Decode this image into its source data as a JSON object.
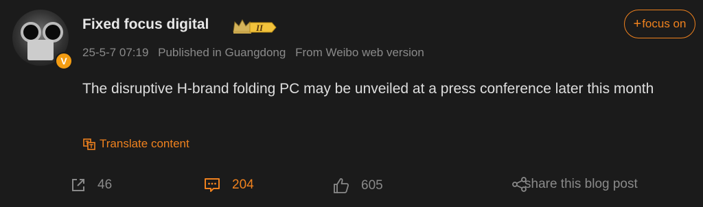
{
  "user": {
    "name": "Fixed focus digital",
    "verified_badge": "V",
    "level_badge": "II"
  },
  "follow_button": {
    "plus": "+",
    "label": "focus on"
  },
  "meta": {
    "timestamp": "25-5-7 07:19",
    "location": "Published in Guangdong",
    "source": "From Weibo web version"
  },
  "post": {
    "text": "The disruptive H-brand folding PC may be unveiled at a press conference later this month"
  },
  "translate": {
    "label": "Translate content"
  },
  "actions": {
    "repost_count": "46",
    "comment_count": "204",
    "like_count": "605",
    "share_label": "share this blog post"
  },
  "colors": {
    "background": "#1b1b1b",
    "accent": "#f0821e",
    "muted": "#8a8a8a",
    "text": "#dedede"
  },
  "icons": [
    "repost-icon",
    "comment-icon",
    "like-icon",
    "share-icon",
    "translate-icon",
    "crown-icon"
  ]
}
